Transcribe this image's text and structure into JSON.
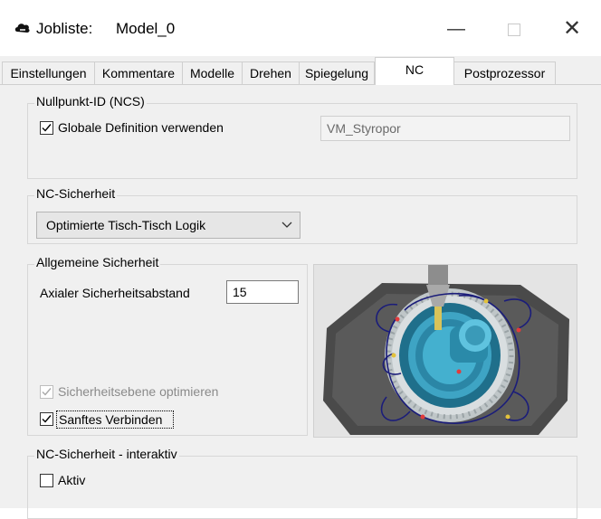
{
  "window": {
    "title_label": "Jobliste:",
    "title_value": "Model_0",
    "app_icon": "cloud-icon",
    "controls": [
      "minimize-icon",
      "maximize-icon",
      "close-icon"
    ]
  },
  "tabs": [
    {
      "label": "Einstellungen",
      "active": false
    },
    {
      "label": "Kommentare",
      "active": false
    },
    {
      "label": "Modelle",
      "active": false
    },
    {
      "label": "Drehen",
      "active": false
    },
    {
      "label": "Spiegelung",
      "active": false
    },
    {
      "label": "NC",
      "active": true
    },
    {
      "label": "Postprozessor",
      "active": false
    }
  ],
  "nullpunkt": {
    "group_label": "Nullpunkt-ID (NCS)",
    "checkbox_label": "Globale Definition verwenden",
    "checked": true,
    "field_value": "VM_Styropor"
  },
  "nc_sicherheit": {
    "group_label": "NC-Sicherheit",
    "selected": "Optimierte Tisch-Tisch Logik"
  },
  "allgemein": {
    "group_label": "Allgemeine Sicherheit",
    "axial_label": "Axialer Sicherheitsabstand",
    "axial_value": "15",
    "opt_label": "Sicherheitsebene optimieren",
    "opt_checked": true,
    "opt_enabled": false,
    "sanft_label": "Sanftes Verbinden",
    "sanft_checked": true
  },
  "interaktiv": {
    "group_label": "NC-Sicherheit - interaktiv",
    "aktiv_label": "Aktiv",
    "aktiv_checked": false
  }
}
